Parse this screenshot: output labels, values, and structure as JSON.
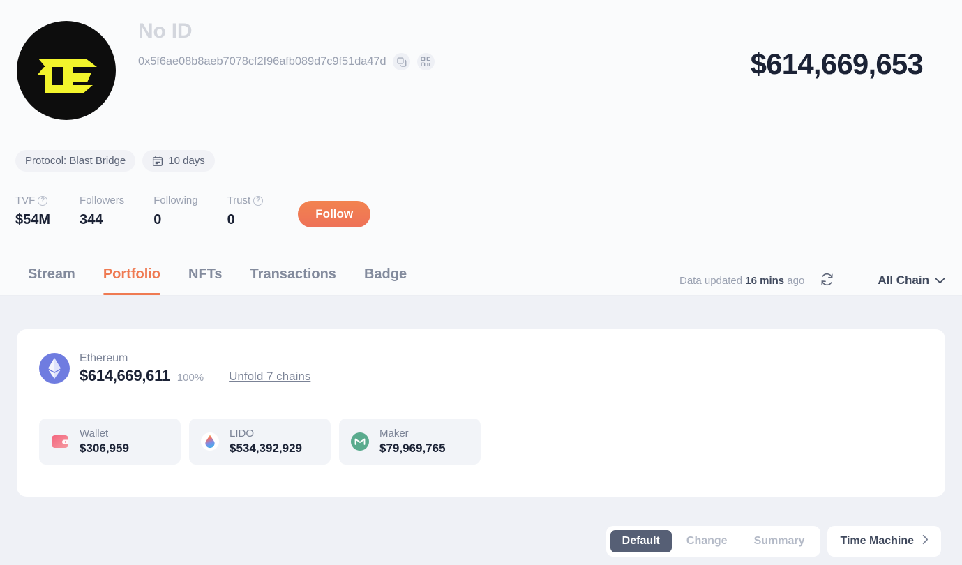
{
  "profile": {
    "name": "No ID",
    "address": "0x5f6ae08b8aeb7078cf2f96afb089d7c9f51da47d",
    "total_value": "$614,669,653",
    "avatar_icon": "blast-logo-icon",
    "copy_icon": "copy-icon",
    "qr_icon": "qr-code-icon",
    "tags": [
      {
        "label": "Protocol: Blast Bridge",
        "icon": null
      },
      {
        "label": "10 days",
        "icon": "calendar-icon"
      }
    ],
    "stats": [
      {
        "label": "TVF",
        "value": "$54M",
        "help": true
      },
      {
        "label": "Followers",
        "value": "344",
        "help": false
      },
      {
        "label": "Following",
        "value": "0",
        "help": false
      },
      {
        "label": "Trust",
        "value": "0",
        "help": true
      }
    ],
    "follow_label": "Follow"
  },
  "tabs": {
    "items": [
      {
        "label": "Stream",
        "active": false
      },
      {
        "label": "Portfolio",
        "active": true
      },
      {
        "label": "NFTs",
        "active": false
      },
      {
        "label": "Transactions",
        "active": false
      },
      {
        "label": "Badge",
        "active": false
      }
    ],
    "updated_prefix": "Data updated",
    "updated_value": "16 mins",
    "updated_suffix": "ago",
    "refresh_icon": "refresh-icon",
    "chain_filter": "All Chain",
    "chain_filter_icon": "chevron-down-icon"
  },
  "portfolio": {
    "chain": {
      "name": "Ethereum",
      "icon": "ethereum-icon",
      "amount": "$614,669,611",
      "percent": "100%",
      "unfold_label": "Unfold 7 chains"
    },
    "holdings": [
      {
        "name": "Wallet",
        "amount": "$306,959",
        "icon": "wallet-icon"
      },
      {
        "name": "LIDO",
        "amount": "$534,392,929",
        "icon": "lido-droplet-icon"
      },
      {
        "name": "Maker",
        "amount": "$79,969,765",
        "icon": "maker-icon"
      }
    ]
  },
  "footer": {
    "segments": [
      {
        "label": "Default",
        "active": true
      },
      {
        "label": "Change",
        "active": false
      },
      {
        "label": "Summary",
        "active": false
      }
    ],
    "time_machine_label": "Time Machine",
    "time_machine_icon": "chevron-right-icon"
  },
  "colors": {
    "accent": "#ef7a52",
    "text_dark": "#1b2235",
    "text_muted": "#9aa1b1",
    "bg_main": "#eff1f6",
    "bg_header": "#fafbfc",
    "eth_purple": "#6f7ce0",
    "maker_green": "#5aab8e",
    "segment_active": "#565f75"
  }
}
